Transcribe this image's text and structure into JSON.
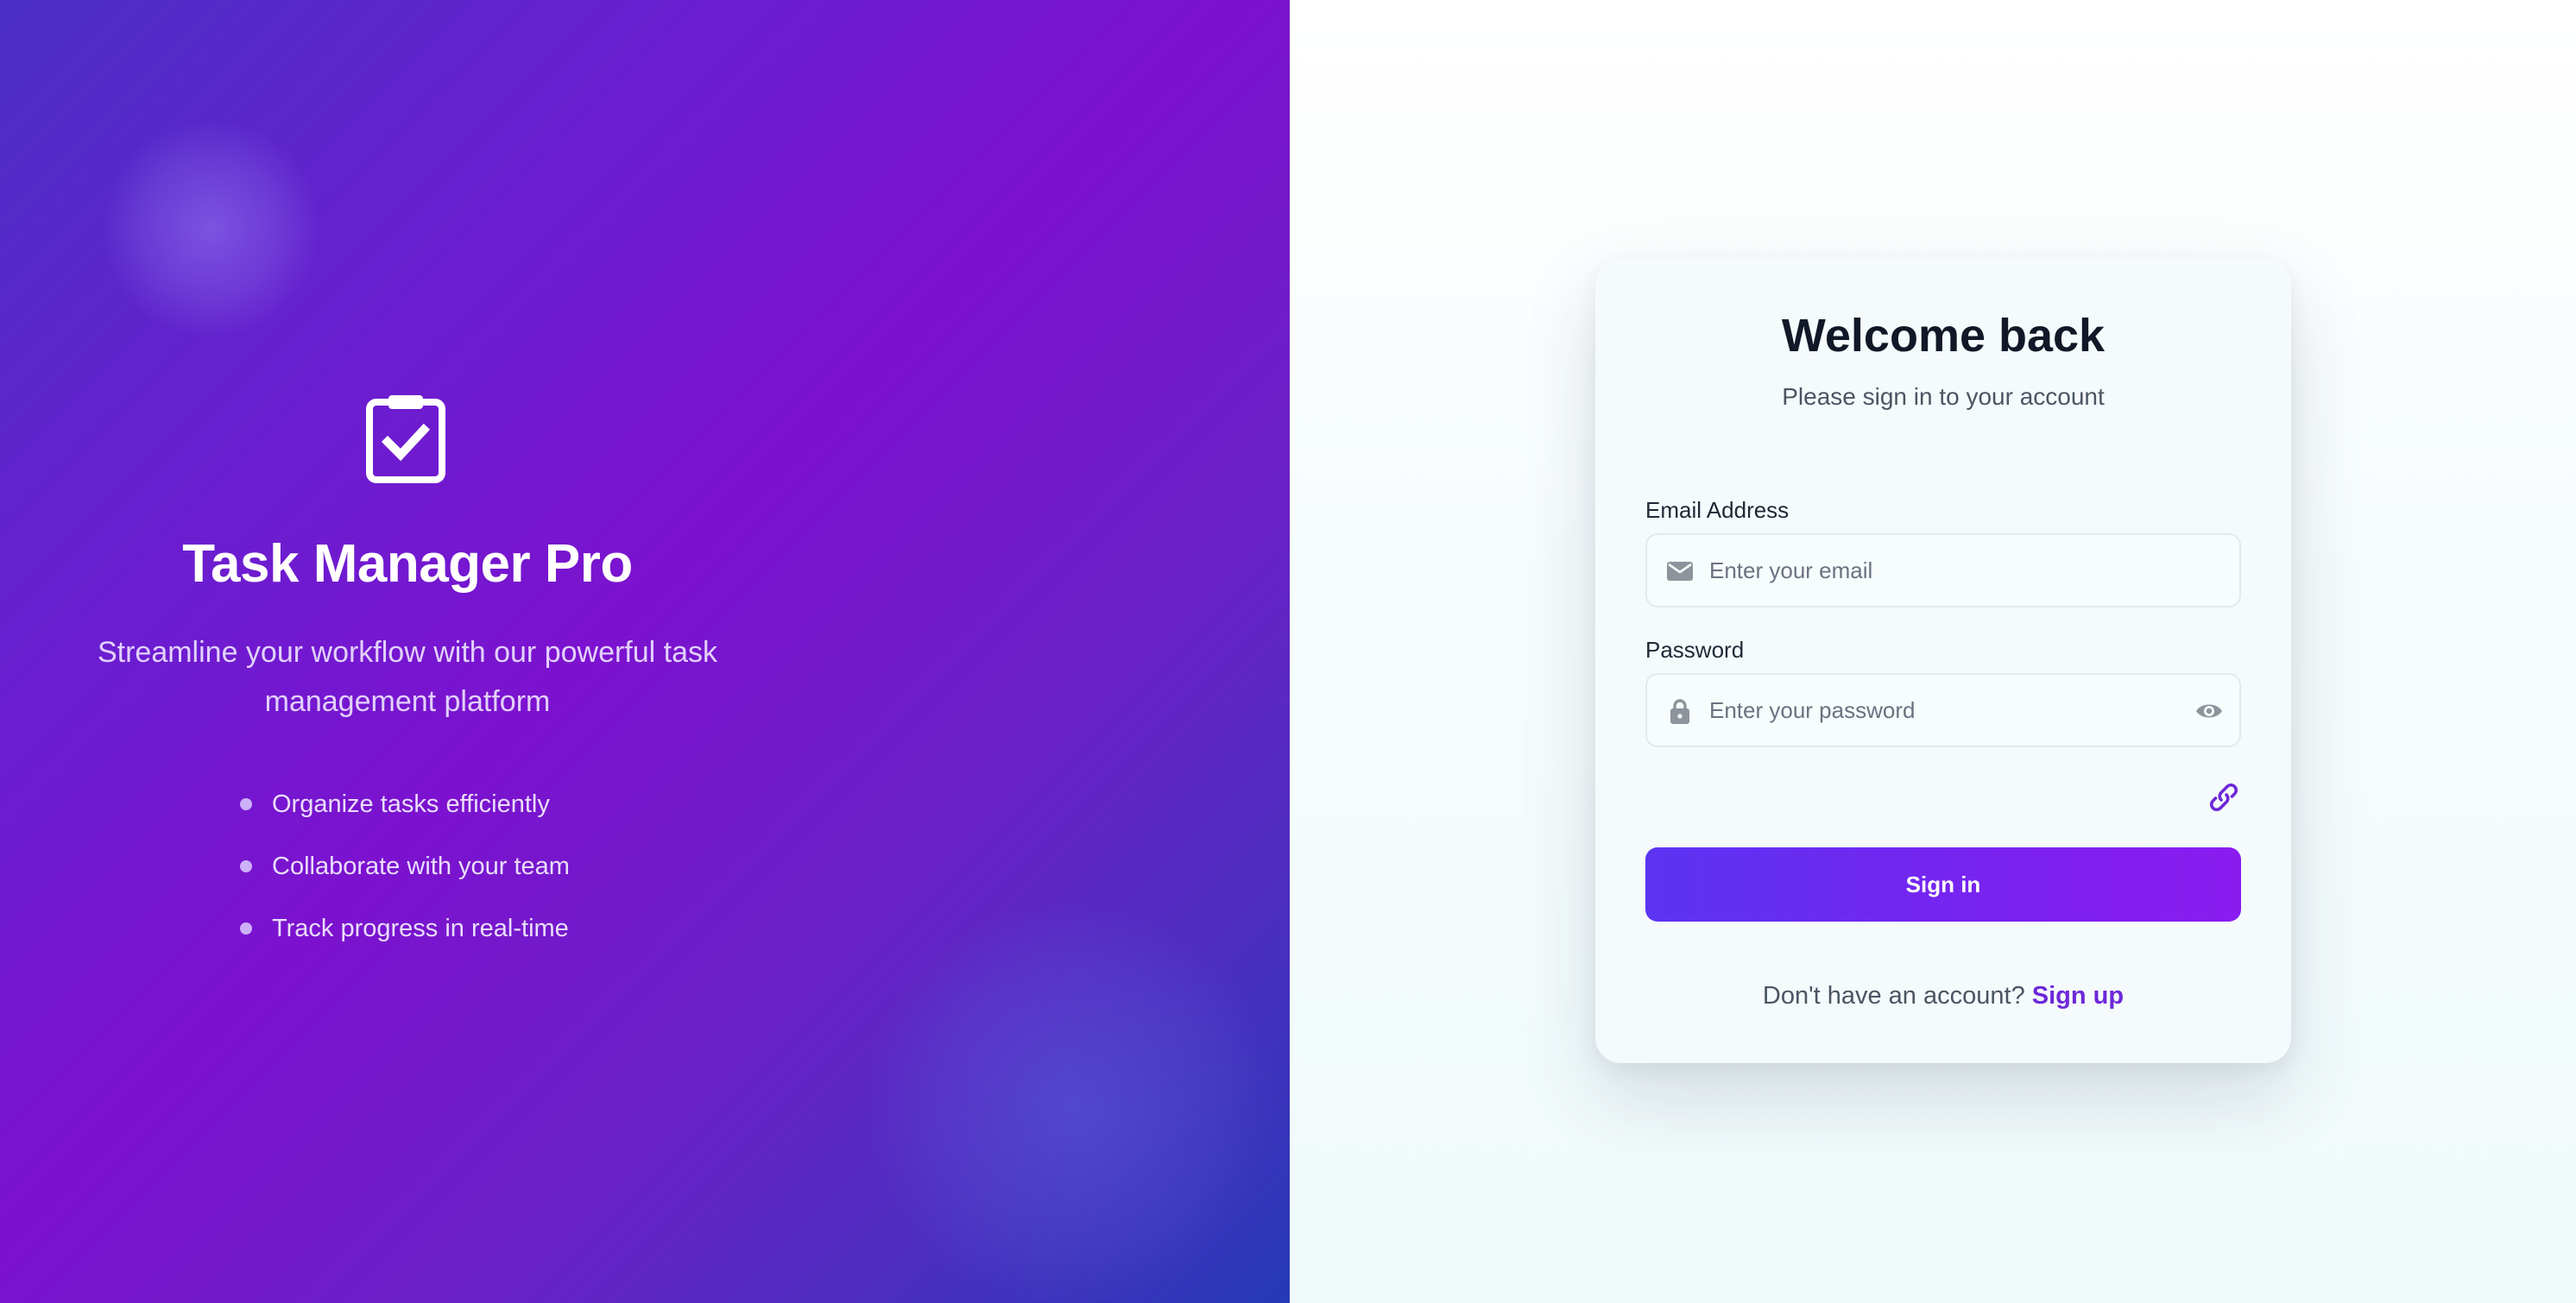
{
  "hero": {
    "title": "Task Manager Pro",
    "subtitle": "Streamline your workflow with our powerful task management platform",
    "logo_icon": "clipboard-check-icon",
    "features": [
      "Organize tasks efficiently",
      "Collaborate with your team",
      "Track progress in real-time"
    ]
  },
  "login": {
    "title": "Welcome back",
    "subtitle": "Please sign in to your account",
    "email": {
      "label": "Email Address",
      "placeholder": "Enter your email",
      "value": "",
      "icon": "mail-icon"
    },
    "password": {
      "label": "Password",
      "placeholder": "Enter your password",
      "value": "",
      "icon": "lock-icon",
      "toggle_icon": "eye-icon"
    },
    "link_icon": "link-icon",
    "submit_label": "Sign in",
    "signup_prompt": "Don't have an account?",
    "signup_link": "Sign up"
  },
  "colors": {
    "accent": "#6d28d9",
    "button_start": "#5b34f2",
    "button_end": "#8a1cf0",
    "hero_mid": "#7c12cf",
    "hero_edge": "#2539b6"
  }
}
